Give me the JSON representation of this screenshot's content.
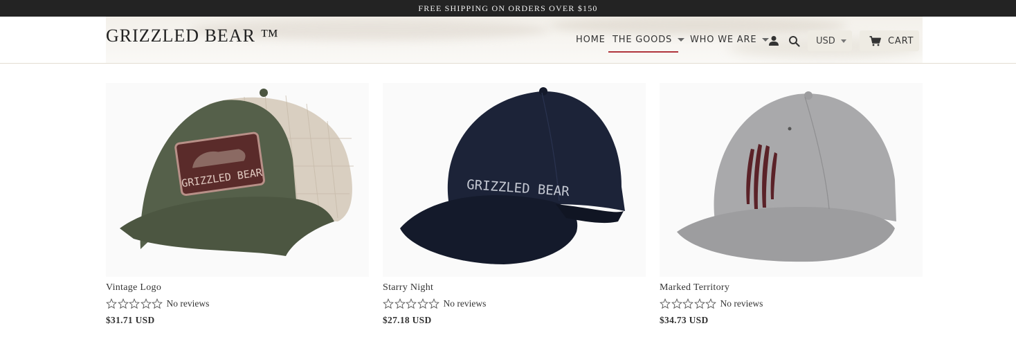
{
  "promo": {
    "text": "FREE SHIPPING ON ORDERS OVER $150"
  },
  "brand": {
    "name": "GRIZZLED BEAR ™"
  },
  "nav": {
    "items": [
      {
        "label": "HOME"
      },
      {
        "label": "THE GOODS"
      },
      {
        "label": "WHO WE ARE"
      }
    ],
    "active": "THE GOODS"
  },
  "currency": {
    "selected": "USD"
  },
  "cart": {
    "label": "CART"
  },
  "products": [
    {
      "title": "Vintage Logo",
      "reviews": "No reviews",
      "price": "$31.71 USD",
      "patch_text": "GRIZZLED BEAR",
      "colors": {
        "crown": "#55604a",
        "mesh": "#d9cfc1",
        "visor": "#4c5641"
      }
    },
    {
      "title": "Starry Night",
      "reviews": "No reviews",
      "price": "$27.18 USD",
      "patch_text": "GRIZZLED BEAR",
      "colors": {
        "crown": "#1c2338",
        "visor": "#141a2b"
      }
    },
    {
      "title": "Marked Territory",
      "reviews": "No reviews",
      "price": "$34.73 USD",
      "colors": {
        "crown": "#a9a9ab",
        "visor": "#9d9d9f",
        "claw": "#5b2228"
      }
    }
  ],
  "colors": {
    "promo_bg": "#232323",
    "accent": "#b0343b",
    "button_bg": "#eeebe3"
  }
}
